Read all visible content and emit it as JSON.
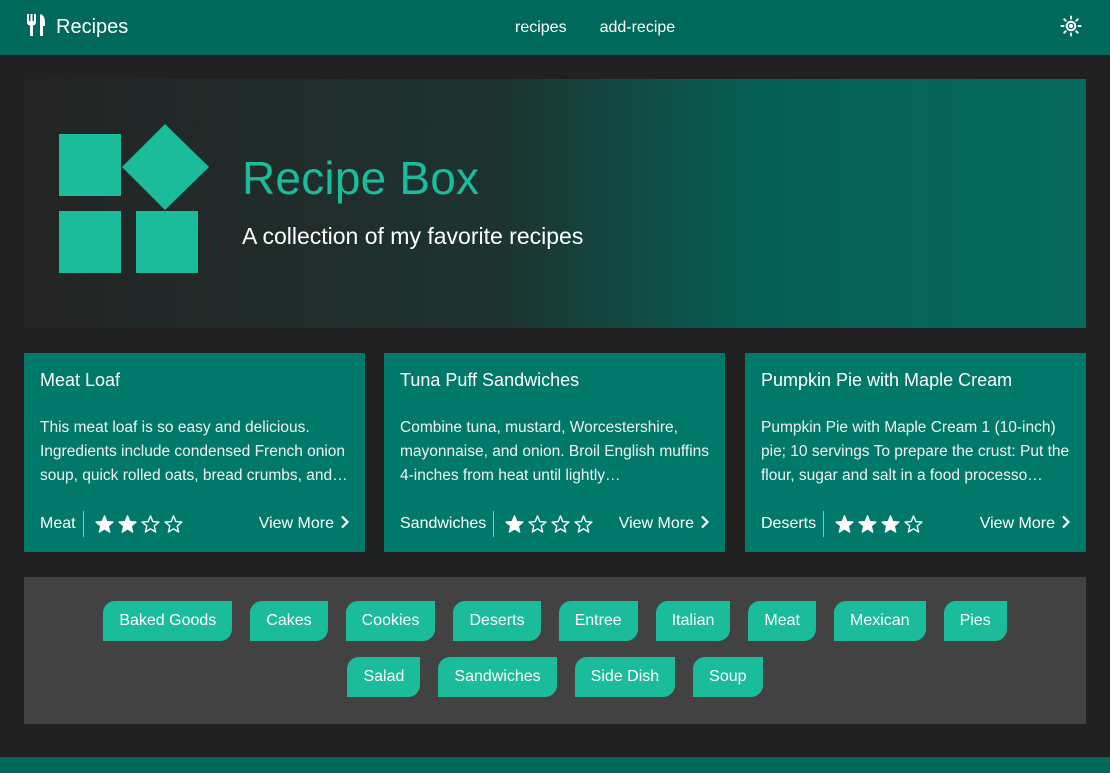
{
  "colors": {
    "primary": "#00695c",
    "card": "#00796b",
    "accent": "#1abc9c",
    "background": "#212121",
    "panel": "#424242"
  },
  "nav": {
    "brand_icon": "fork-knife-icon",
    "brand_label": "Recipes",
    "links": [
      "recipes",
      "add-recipe"
    ],
    "theme_icon": "sun-icon"
  },
  "hero": {
    "logo_icon": "blocks-logo-icon",
    "title": "Recipe Box",
    "subtitle": "A collection of my favorite recipes"
  },
  "cards": [
    {
      "title": "Meat Loaf",
      "description": "This meat loaf is so easy and delicious. Ingredients include condensed French onion soup, quick rolled oats, bread crumbs, and…",
      "category": "Meat",
      "rating": 2,
      "max_rating": 4,
      "link_label": "View More"
    },
    {
      "title": "Tuna Puff Sandwiches",
      "description": "Combine tuna, mustard, Worcestershire, mayonnaise, and onion. Broil English muffins 4-inches from heat until lightly…",
      "category": "Sandwiches",
      "rating": 1,
      "max_rating": 4,
      "link_label": "View More"
    },
    {
      "title": "Pumpkin Pie with Maple Cream",
      "description": "Pumpkin Pie with Maple Cream 1 (10-inch) pie; 10 servings To prepare the crust: Put the flour, sugar and salt in a food processo…",
      "category": "Deserts",
      "rating": 3,
      "max_rating": 4,
      "link_label": "View More"
    }
  ],
  "tags": [
    "Baked Goods",
    "Cakes",
    "Cookies",
    "Deserts",
    "Entree",
    "Italian",
    "Meat",
    "Mexican",
    "Pies",
    "Salad",
    "Sandwiches",
    "Side Dish",
    "Soup"
  ]
}
